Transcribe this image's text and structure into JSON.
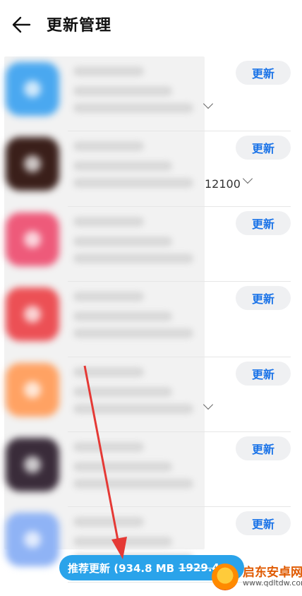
{
  "header": {
    "title": "更新管理"
  },
  "apps": [
    {
      "update_label": "更新",
      "icon_color": "#4aa8f0",
      "meta": "",
      "has_chevron": true
    },
    {
      "update_label": "更新",
      "icon_color": "#3a1f1a",
      "meta": "12100",
      "has_chevron": true
    },
    {
      "update_label": "更新",
      "icon_color": "#ee5a7a",
      "meta": "",
      "has_chevron": false
    },
    {
      "update_label": "更新",
      "icon_color": "#ec5055",
      "meta": "",
      "has_chevron": false
    },
    {
      "update_label": "更新",
      "icon_color": "#ffa263",
      "meta": "",
      "has_chevron": true
    },
    {
      "update_label": "更新",
      "icon_color": "#3a2c3a",
      "meta": "",
      "has_chevron": false
    },
    {
      "update_label": "更新",
      "icon_color": "#8fb3f5",
      "meta": "",
      "has_chevron": false
    }
  ],
  "bottom": {
    "label": "推荐更新 (934.8 MB",
    "original_size": "1929.4"
  },
  "watermark": {
    "name": "启东安卓网",
    "url": "www.qdltdw.com"
  },
  "colors": {
    "accent": "#1a73e8",
    "bottom_bar": "#2aa3ea",
    "arrow": "#e53935"
  }
}
